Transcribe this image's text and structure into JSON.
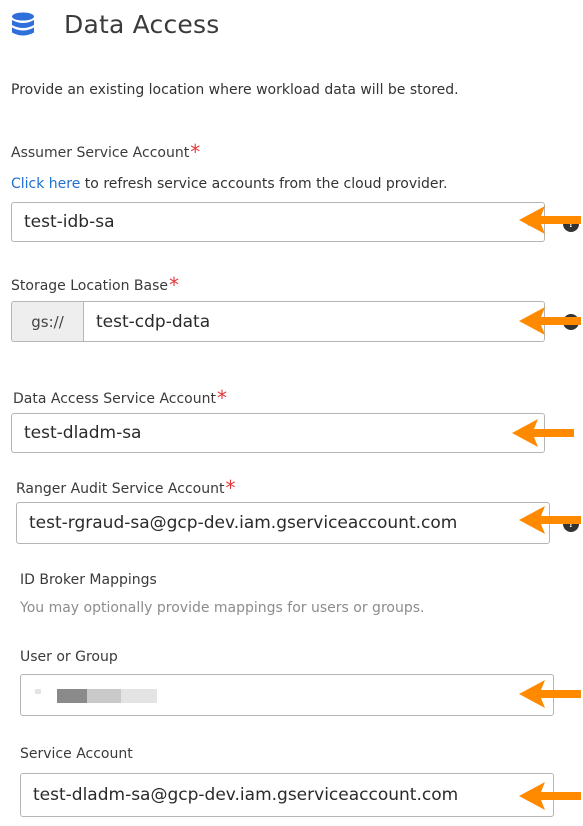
{
  "header": {
    "title": "Data Access",
    "description": "Provide an existing location where workload data will be stored."
  },
  "assumer": {
    "label": "Assumer Service Account",
    "required_mark": "*",
    "refresh_link": "Click here",
    "refresh_text": " to refresh service accounts from the cloud provider.",
    "value": "test-idb-sa"
  },
  "storage": {
    "label": "Storage Location Base",
    "required_mark": "*",
    "prefix": "gs://",
    "value": "test-cdp-data"
  },
  "data_access": {
    "label": "Data Access Service Account",
    "required_mark": "*",
    "value": "test-dladm-sa"
  },
  "ranger": {
    "label": "Ranger Audit Service Account",
    "required_mark": "*",
    "value": "test-rgraud-sa@gcp-dev.iam.gserviceaccount.com"
  },
  "id_broker": {
    "heading": "ID Broker Mappings",
    "hint": "You may optionally provide mappings for users or groups."
  },
  "user_group": {
    "label": "User or Group"
  },
  "service_account": {
    "label": "Service Account",
    "value": "test-dladm-sa@gcp-dev.iam.gserviceaccount.com"
  },
  "colors": {
    "accent_icon": "#2f6fdb",
    "arrow": "#ff8a00",
    "required": "#e5383b",
    "link": "#1f6fd1"
  },
  "icons": {
    "header": "database-icon",
    "help": "help-circle-icon",
    "annotation": "arrow-left-icon"
  }
}
